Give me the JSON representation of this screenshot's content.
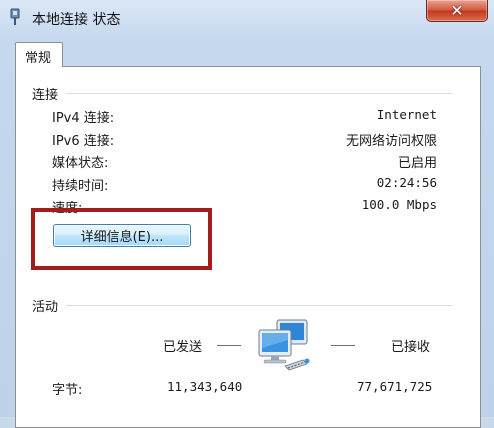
{
  "window": {
    "title": "本地连接 状态",
    "close_label": "✕"
  },
  "tabs": [
    {
      "label": "常规"
    }
  ],
  "connection": {
    "section_label": "连接",
    "rows": [
      {
        "label": "IPv4 连接:",
        "value": "Internet"
      },
      {
        "label": "IPv6 连接:",
        "value": "无网络访问权限"
      },
      {
        "label": "媒体状态:",
        "value": "已启用"
      },
      {
        "label": "持续时间:",
        "value": "02:24:56"
      },
      {
        "label": "速度:",
        "value": "100.0 Mbps"
      }
    ],
    "details_button": "详细信息(E)..."
  },
  "activity": {
    "section_label": "活动",
    "sent_label": "已发送",
    "received_label": "已接收",
    "bytes_label": "字节:",
    "bytes_sent": "11,343,640",
    "bytes_received": "77,671,725"
  },
  "annotation": {
    "highlight_color": "#a51c1c"
  },
  "icons": {
    "window_icon": "network-connection-icon",
    "activity_icon": "network-computers-icon"
  }
}
